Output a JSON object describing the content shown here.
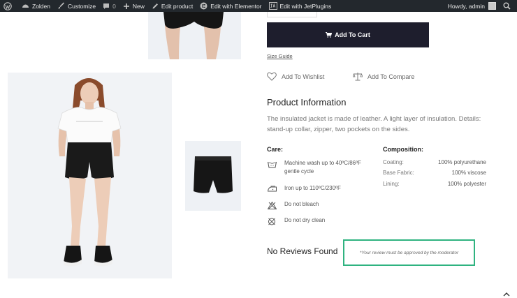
{
  "adminbar": {
    "site_name": "Zolden",
    "customize": "Customize",
    "comments_count": "0",
    "new_label": "New",
    "edit_product": "Edit product",
    "edit_elementor": "Edit with Elementor",
    "edit_jetplugins": "Edit with JetPlugins",
    "howdy": "Howdy, admin"
  },
  "product": {
    "add_to_cart": "Add To Cart",
    "size_guide": "Size Guide",
    "wishlist": "Add To Wishlist",
    "compare": "Add To Compare"
  },
  "info": {
    "title": "Product Information",
    "description": "The insulated jacket is made of leather. A light layer of insulation. Details: stand-up collar, zipper, two pockets on the sides."
  },
  "care": {
    "title": "Care:",
    "items": [
      {
        "text": "Machine wash up to 40ºC/86ºF gentle cycle",
        "icon": "wash-icon"
      },
      {
        "text": "Iron up to 110ºC/230ºF",
        "icon": "iron-icon"
      },
      {
        "text": "Do not bleach",
        "icon": "no-bleach-icon"
      },
      {
        "text": "Do not dry clean",
        "icon": "no-dry-clean-icon"
      }
    ]
  },
  "composition": {
    "title": "Composition:",
    "rows": [
      {
        "label": "Coating:",
        "value": "100% polyurethane"
      },
      {
        "label": "Base Fabric:",
        "value": "100% viscose"
      },
      {
        "label": "Lining:",
        "value": "100% polyester"
      }
    ]
  },
  "reviews": {
    "title": "No Reviews Found",
    "moderator_note": "*Your review must be approved by the moderator"
  },
  "colors": {
    "adminbar": "#23282d",
    "button": "#1e1e2d",
    "review_border": "#2fb380"
  }
}
